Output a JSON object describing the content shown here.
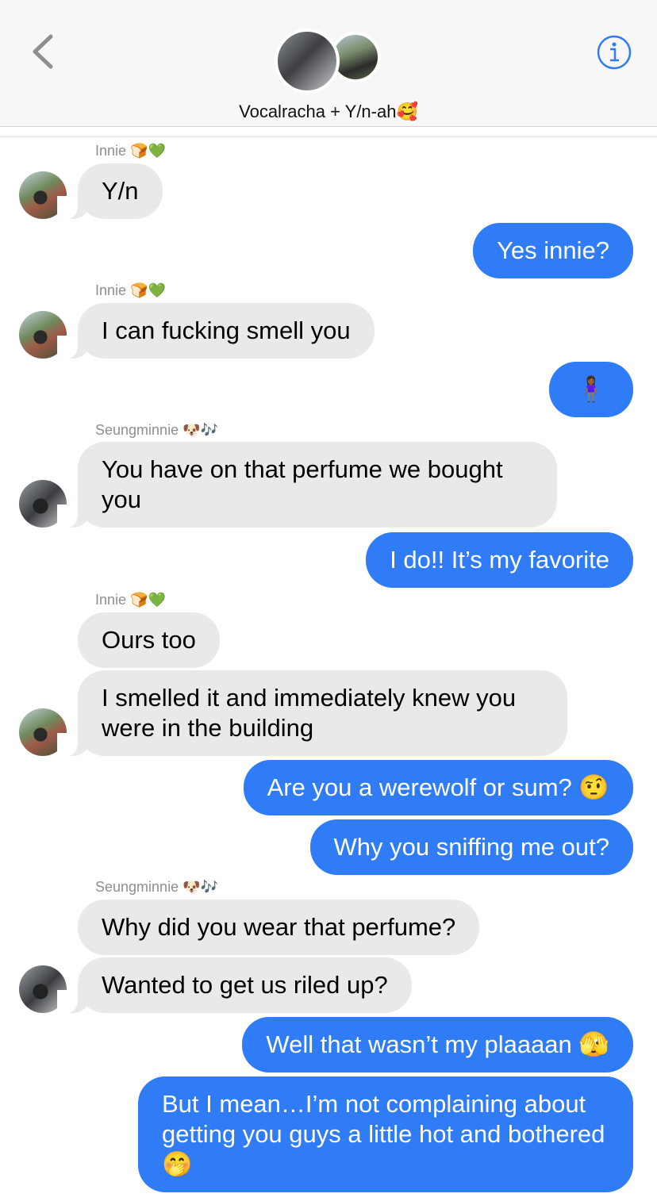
{
  "header": {
    "chat_title": "Vocalracha + Y/n-ah🥰",
    "back_icon": "chevron-left-icon",
    "info_icon": "info-circle-icon",
    "accent": "#2f7cf6"
  },
  "senders": {
    "innie": "Innie 🍞💚",
    "seungminnie": "Seungminnie 🐶🎶"
  },
  "messages": [
    {
      "text": "Y/n"
    },
    {
      "text": "Yes innie?"
    },
    {
      "text": "I can fucking smell you"
    },
    {
      "text": "🧍🏾‍♀️"
    },
    {
      "text": "You have on that perfume we bought you"
    },
    {
      "text": "I do!! It’s my favorite"
    },
    {
      "text": "Ours too"
    },
    {
      "text": "I smelled it and immediately knew you were in the building"
    },
    {
      "text": "Are you a werewolf or sum? 🤨"
    },
    {
      "text": "Why you sniffing me out?"
    },
    {
      "text": "Why did you wear that perfume?"
    },
    {
      "text": "Wanted to get us riled up?"
    },
    {
      "text": "Well that wasn’t my plaaaan 🫣"
    },
    {
      "text": "But I mean…I’m not complaining about getting you guys a little hot and bothered 🤭"
    }
  ],
  "colors": {
    "incoming_bubble": "#e9e9eb",
    "outgoing_bubble": "#2f7cf6"
  }
}
